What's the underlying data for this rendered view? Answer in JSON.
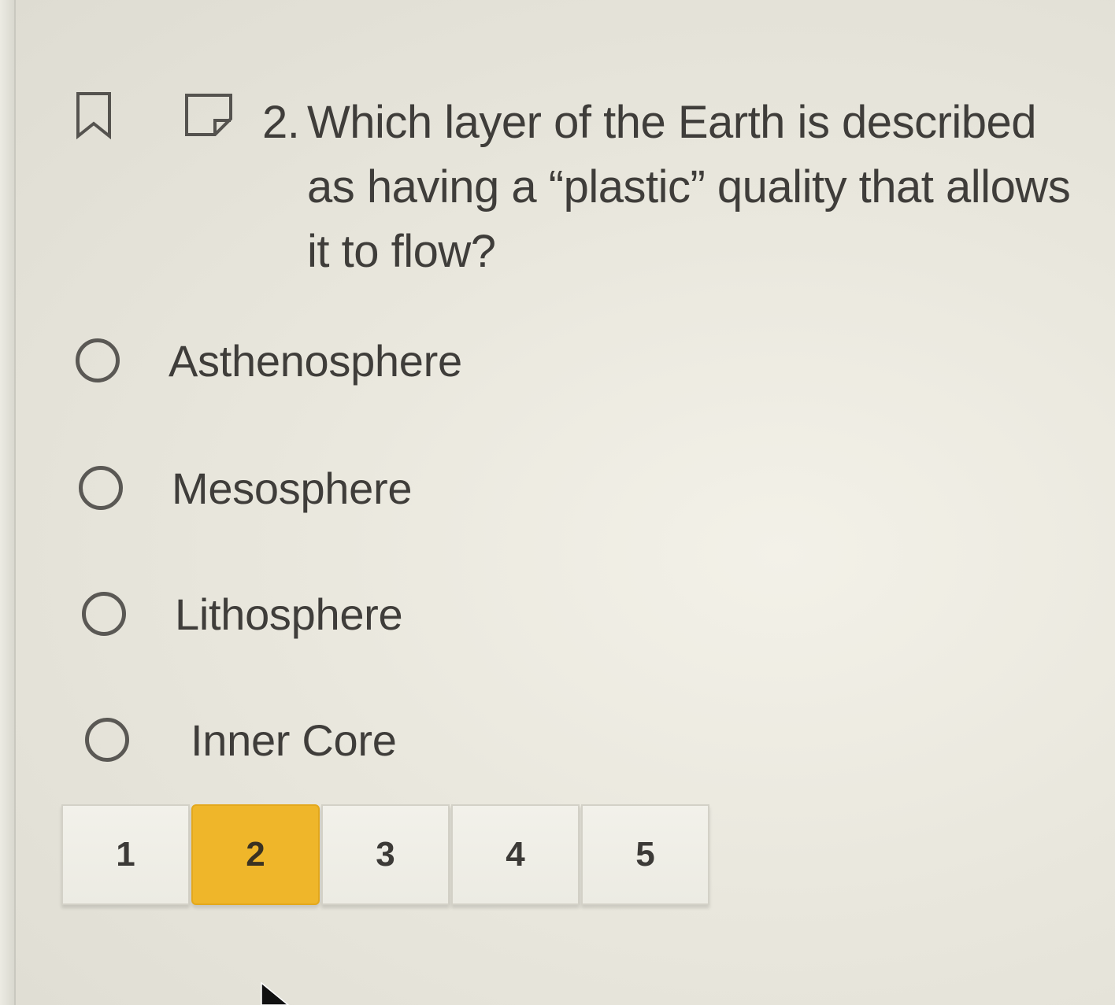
{
  "question": {
    "number": "2.",
    "text": "Which layer of the Earth is described as having a “plastic” quality that allows it to flow?"
  },
  "toolbar_icons": {
    "bookmark": "bookmark-icon",
    "note": "note-icon"
  },
  "options": [
    {
      "label": "Asthenosphere",
      "selected": false
    },
    {
      "label": "Mesosphere",
      "selected": false
    },
    {
      "label": "Lithosphere",
      "selected": false
    },
    {
      "label": "Inner Core",
      "selected": false
    }
  ],
  "pagination": {
    "pages": [
      "1",
      "2",
      "3",
      "4",
      "5"
    ],
    "current": "2"
  },
  "colors": {
    "active_page": "#efb62a",
    "text": "#3f3d3a"
  }
}
